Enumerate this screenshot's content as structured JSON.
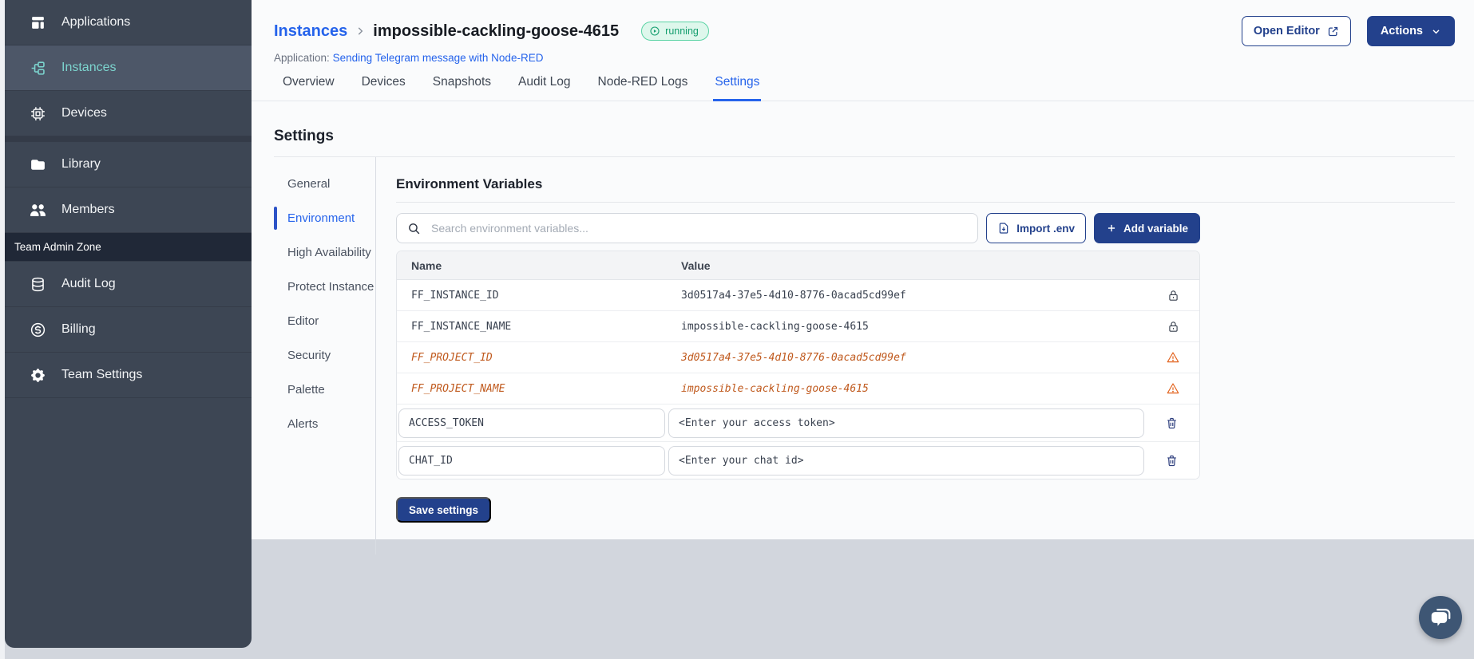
{
  "colors": {
    "primary_button": "#23418c",
    "accent_blue": "#2563eb",
    "sidebar_bg": "#3d4654",
    "sidebar_active_teal": "#7cd4ce",
    "status_running_green": "#149e6e",
    "deprecated_orange": "#c05a1e",
    "page_bottom_gray": "#d2d6dd"
  },
  "sidebar": {
    "items": [
      {
        "label": "Applications"
      },
      {
        "label": "Instances"
      },
      {
        "label": "Devices"
      },
      {
        "label": "Library"
      },
      {
        "label": "Members"
      }
    ],
    "section_label": "Team Admin Zone",
    "admin_items": [
      {
        "label": "Audit Log"
      },
      {
        "label": "Billing"
      },
      {
        "label": "Team Settings"
      }
    ]
  },
  "header": {
    "breadcrumb_root": "Instances",
    "instance_name": "impossible-cackling-goose-4615",
    "status_badge": "running",
    "application_label": "Application:",
    "application_link": "Sending Telegram message with Node-RED",
    "open_editor_button": "Open Editor",
    "actions_button": "Actions"
  },
  "tabs": {
    "items": [
      {
        "label": "Overview"
      },
      {
        "label": "Devices"
      },
      {
        "label": "Snapshots"
      },
      {
        "label": "Audit Log"
      },
      {
        "label": "Node-RED Logs"
      },
      {
        "label": "Settings"
      }
    ]
  },
  "settings": {
    "title": "Settings",
    "nav": [
      {
        "label": "General"
      },
      {
        "label": "Environment"
      },
      {
        "label": "High Availability"
      },
      {
        "label": "Protect Instance"
      },
      {
        "label": "Editor"
      },
      {
        "label": "Security"
      },
      {
        "label": "Palette"
      },
      {
        "label": "Alerts"
      }
    ],
    "section_title": "Environment Variables",
    "search_placeholder": "Search environment variables...",
    "import_button": "Import .env",
    "add_button": "Add variable",
    "table": {
      "columns": [
        "Name",
        "Value"
      ],
      "rows": [
        {
          "name": "FF_INSTANCE_ID",
          "value": "3d0517a4-37e5-4d10-8776-0acad5cd99ef",
          "state": "locked"
        },
        {
          "name": "FF_INSTANCE_NAME",
          "value": "impossible-cackling-goose-4615",
          "state": "locked"
        },
        {
          "name": "FF_PROJECT_ID",
          "value": "3d0517a4-37e5-4d10-8776-0acad5cd99ef",
          "state": "deprecated"
        },
        {
          "name": "FF_PROJECT_NAME",
          "value": "impossible-cackling-goose-4615",
          "state": "deprecated"
        },
        {
          "name": "ACCESS_TOKEN",
          "value": "<Enter your access token>",
          "state": "editable"
        },
        {
          "name": "CHAT_ID",
          "value": "<Enter your chat id>",
          "state": "editable"
        }
      ]
    },
    "save_button": "Save settings"
  }
}
